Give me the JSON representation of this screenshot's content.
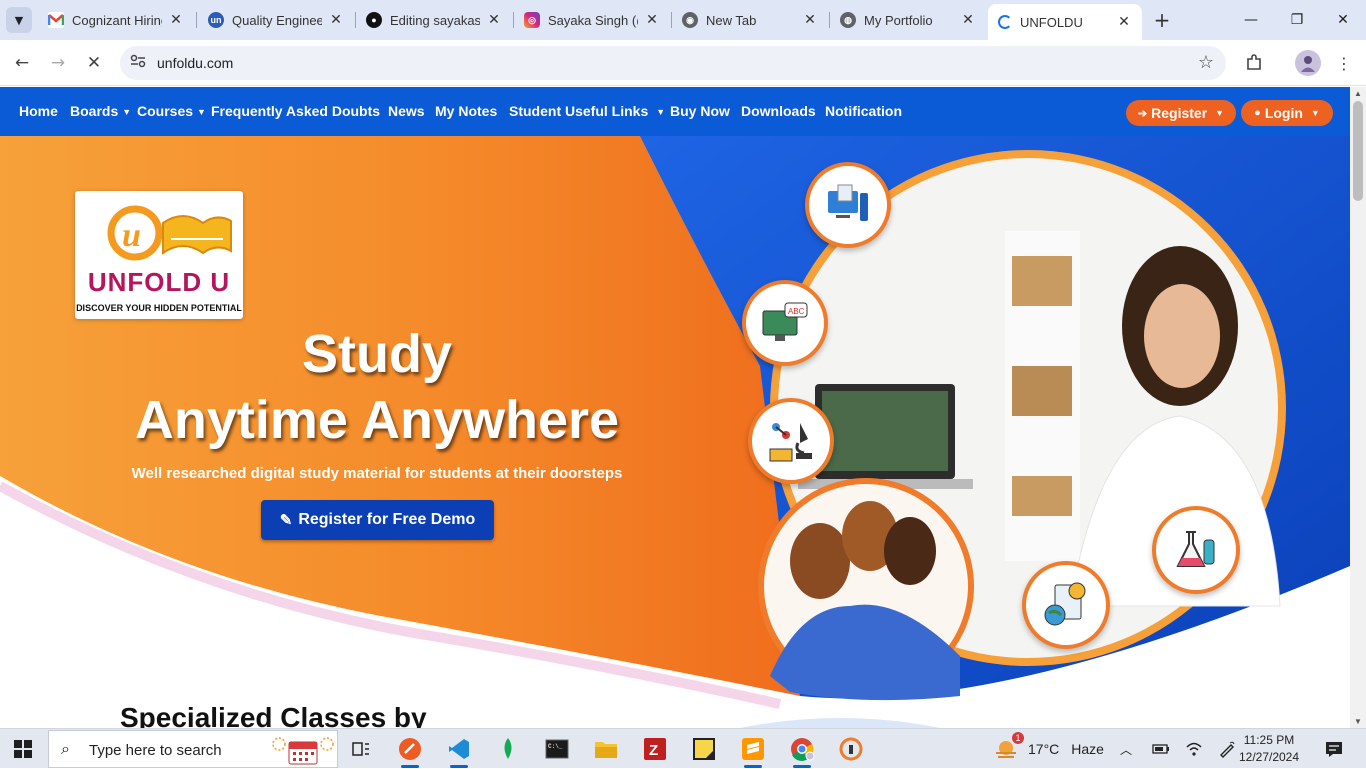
{
  "browser": {
    "tabs": [
      {
        "title": "Cognizant Hiring",
        "icon": "gmail-icon",
        "color": "#ea4335",
        "active": false
      },
      {
        "title": "Quality Engineer",
        "icon": "un-icon",
        "color": "#2b5db8",
        "active": false
      },
      {
        "title": "Editing sayakasi",
        "icon": "github-icon",
        "color": "#111111",
        "active": false
      },
      {
        "title": "Sayaka Singh (@",
        "icon": "instagram-icon",
        "color": "#d62976",
        "active": false
      },
      {
        "title": "New Tab",
        "icon": "chrome-icon",
        "color": "#5f6368",
        "active": false
      },
      {
        "title": "My Portfolio",
        "icon": "globe-icon",
        "color": "#5f6368",
        "active": false
      },
      {
        "title": "UNFOLDU",
        "icon": "loading-icon",
        "color": "#1a73e8",
        "active": true
      }
    ],
    "url": "unfoldu.com"
  },
  "site": {
    "nav": [
      {
        "label": "Home",
        "dropdown": false
      },
      {
        "label": "Boards",
        "dropdown": true
      },
      {
        "label": "Courses",
        "dropdown": true
      },
      {
        "label": "Frequently Asked Doubts",
        "dropdown": false
      },
      {
        "label": "News",
        "dropdown": false
      },
      {
        "label": "My Notes",
        "dropdown": false
      },
      {
        "label": "Student Useful Links",
        "dropdown": true
      },
      {
        "label": "Buy Now",
        "dropdown": false
      },
      {
        "label": "Downloads",
        "dropdown": false
      },
      {
        "label": "Notification",
        "dropdown": false
      }
    ],
    "register_label": "Register",
    "login_label": "Login",
    "colors": {
      "nav": "#0b5ad6",
      "accent": "#ee6221",
      "cta": "#0b3fb3"
    }
  },
  "hero": {
    "logo_brand": "UNFOLD U",
    "logo_tagline": "DISCOVER YOUR HIDDEN POTENTIAL",
    "title_line1": "Study",
    "title_line2": "Anytime Anywhere",
    "subtitle": "Well researched digital study material for students at their doorsteps",
    "cta_label": "Register for Free Demo"
  },
  "section": {
    "heading": "Specialized Classes by"
  },
  "taskbar": {
    "search_placeholder": "Type here to search",
    "weather_temp": "17°C",
    "weather_desc": "Haze",
    "weather_badge": "1",
    "time": "11:25 PM",
    "date": "12/27/2024"
  }
}
